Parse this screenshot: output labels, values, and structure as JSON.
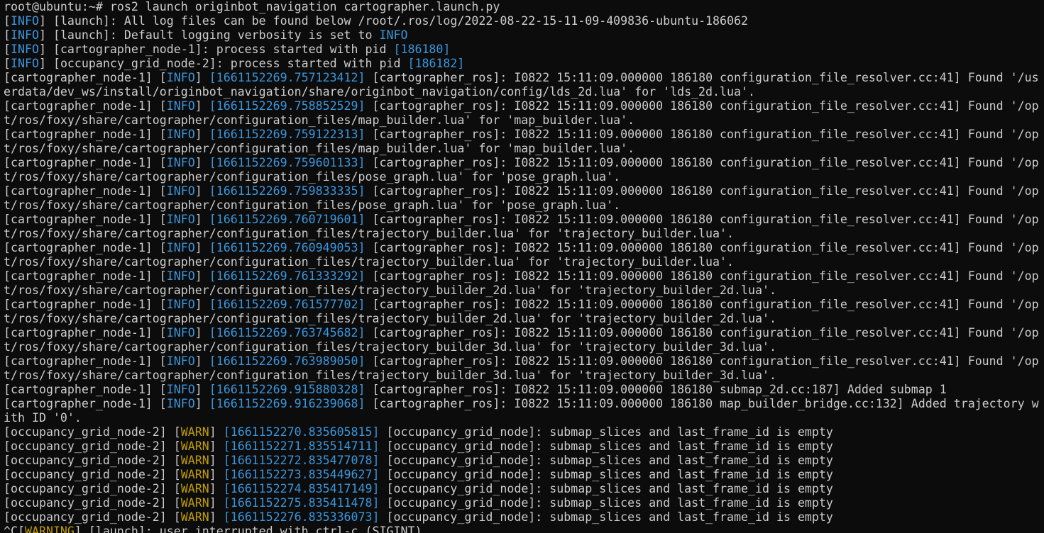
{
  "window": {
    "background": "#0c0c0c",
    "foreground": "#cccccc",
    "info_color": "#3a96dd",
    "warn_color": "#c19c00"
  },
  "lines": [
    [
      {
        "t": "root@ubuntu:~# ros2 launch originbot_navigation cartographer.launch.py",
        "c": "plain"
      }
    ],
    [
      {
        "t": "[",
        "c": "plain"
      },
      {
        "t": "INFO",
        "c": "tag-info"
      },
      {
        "t": "] [launch]: All log files can be found below /root/.ros/log/2022-08-22-15-11-09-409836-ubuntu-186062",
        "c": "plain"
      }
    ],
    [
      {
        "t": "[",
        "c": "plain"
      },
      {
        "t": "INFO",
        "c": "tag-info"
      },
      {
        "t": "] [launch]: Default logging verbosity is set to ",
        "c": "plain"
      },
      {
        "t": "INFO",
        "c": "tag-info"
      }
    ],
    [
      {
        "t": "[",
        "c": "plain"
      },
      {
        "t": "INFO",
        "c": "tag-info"
      },
      {
        "t": "] [cartographer_node-1]: process started with pid ",
        "c": "plain"
      },
      {
        "t": "[186180]",
        "c": "pid"
      }
    ],
    [
      {
        "t": "[",
        "c": "plain"
      },
      {
        "t": "INFO",
        "c": "tag-info"
      },
      {
        "t": "] [occupancy_grid_node-2]: process started with pid ",
        "c": "plain"
      },
      {
        "t": "[186182]",
        "c": "pid"
      }
    ],
    [
      {
        "t": "[cartographer_node-1] [",
        "c": "plain"
      },
      {
        "t": "INFO",
        "c": "tag-info"
      },
      {
        "t": "] ",
        "c": "plain"
      },
      {
        "t": "[1661152269.757123412]",
        "c": "ts"
      },
      {
        "t": " [cartographer_ros]: I0822 15:11:09.000000 186180 configuration_file_resolver.cc:41] Found '/us",
        "c": "plain"
      }
    ],
    [
      {
        "t": "erdata/dev_ws/install/originbot_navigation/share/originbot_navigation/config/lds_2d.lua' for 'lds_2d.lua'.",
        "c": "plain"
      }
    ],
    [
      {
        "t": "[cartographer_node-1] [",
        "c": "plain"
      },
      {
        "t": "INFO",
        "c": "tag-info"
      },
      {
        "t": "] ",
        "c": "plain"
      },
      {
        "t": "[1661152269.758852529]",
        "c": "ts"
      },
      {
        "t": " [cartographer_ros]: I0822 15:11:09.000000 186180 configuration_file_resolver.cc:41] Found '/op",
        "c": "plain"
      }
    ],
    [
      {
        "t": "t/ros/foxy/share/cartographer/configuration_files/map_builder.lua' for 'map_builder.lua'.",
        "c": "plain"
      }
    ],
    [
      {
        "t": "[cartographer_node-1] [",
        "c": "plain"
      },
      {
        "t": "INFO",
        "c": "tag-info"
      },
      {
        "t": "] ",
        "c": "plain"
      },
      {
        "t": "[1661152269.759122313]",
        "c": "ts"
      },
      {
        "t": " [cartographer_ros]: I0822 15:11:09.000000 186180 configuration_file_resolver.cc:41] Found '/op",
        "c": "plain"
      }
    ],
    [
      {
        "t": "t/ros/foxy/share/cartographer/configuration_files/map_builder.lua' for 'map_builder.lua'.",
        "c": "plain"
      }
    ],
    [
      {
        "t": "[cartographer_node-1] [",
        "c": "plain"
      },
      {
        "t": "INFO",
        "c": "tag-info"
      },
      {
        "t": "] ",
        "c": "plain"
      },
      {
        "t": "[1661152269.759601133]",
        "c": "ts"
      },
      {
        "t": " [cartographer_ros]: I0822 15:11:09.000000 186180 configuration_file_resolver.cc:41] Found '/op",
        "c": "plain"
      }
    ],
    [
      {
        "t": "t/ros/foxy/share/cartographer/configuration_files/pose_graph.lua' for 'pose_graph.lua'.",
        "c": "plain"
      }
    ],
    [
      {
        "t": "[cartographer_node-1] [",
        "c": "plain"
      },
      {
        "t": "INFO",
        "c": "tag-info"
      },
      {
        "t": "] ",
        "c": "plain"
      },
      {
        "t": "[1661152269.759833335]",
        "c": "ts"
      },
      {
        "t": " [cartographer_ros]: I0822 15:11:09.000000 186180 configuration_file_resolver.cc:41] Found '/op",
        "c": "plain"
      }
    ],
    [
      {
        "t": "t/ros/foxy/share/cartographer/configuration_files/pose_graph.lua' for 'pose_graph.lua'.",
        "c": "plain"
      }
    ],
    [
      {
        "t": "[cartographer_node-1] [",
        "c": "plain"
      },
      {
        "t": "INFO",
        "c": "tag-info"
      },
      {
        "t": "] ",
        "c": "plain"
      },
      {
        "t": "[1661152269.760719601]",
        "c": "ts"
      },
      {
        "t": " [cartographer_ros]: I0822 15:11:09.000000 186180 configuration_file_resolver.cc:41] Found '/op",
        "c": "plain"
      }
    ],
    [
      {
        "t": "t/ros/foxy/share/cartographer/configuration_files/trajectory_builder.lua' for 'trajectory_builder.lua'.",
        "c": "plain"
      }
    ],
    [
      {
        "t": "[cartographer_node-1] [",
        "c": "plain"
      },
      {
        "t": "INFO",
        "c": "tag-info"
      },
      {
        "t": "] ",
        "c": "plain"
      },
      {
        "t": "[1661152269.760949053]",
        "c": "ts"
      },
      {
        "t": " [cartographer_ros]: I0822 15:11:09.000000 186180 configuration_file_resolver.cc:41] Found '/op",
        "c": "plain"
      }
    ],
    [
      {
        "t": "t/ros/foxy/share/cartographer/configuration_files/trajectory_builder.lua' for 'trajectory_builder.lua'.",
        "c": "plain"
      }
    ],
    [
      {
        "t": "[cartographer_node-1] [",
        "c": "plain"
      },
      {
        "t": "INFO",
        "c": "tag-info"
      },
      {
        "t": "] ",
        "c": "plain"
      },
      {
        "t": "[1661152269.761333292]",
        "c": "ts"
      },
      {
        "t": " [cartographer_ros]: I0822 15:11:09.000000 186180 configuration_file_resolver.cc:41] Found '/op",
        "c": "plain"
      }
    ],
    [
      {
        "t": "t/ros/foxy/share/cartographer/configuration_files/trajectory_builder_2d.lua' for 'trajectory_builder_2d.lua'.",
        "c": "plain"
      }
    ],
    [
      {
        "t": "[cartographer_node-1] [",
        "c": "plain"
      },
      {
        "t": "INFO",
        "c": "tag-info"
      },
      {
        "t": "] ",
        "c": "plain"
      },
      {
        "t": "[1661152269.761577702]",
        "c": "ts"
      },
      {
        "t": " [cartographer_ros]: I0822 15:11:09.000000 186180 configuration_file_resolver.cc:41] Found '/op",
        "c": "plain"
      }
    ],
    [
      {
        "t": "t/ros/foxy/share/cartographer/configuration_files/trajectory_builder_2d.lua' for 'trajectory_builder_2d.lua'.",
        "c": "plain"
      }
    ],
    [
      {
        "t": "[cartographer_node-1] [",
        "c": "plain"
      },
      {
        "t": "INFO",
        "c": "tag-info"
      },
      {
        "t": "] ",
        "c": "plain"
      },
      {
        "t": "[1661152269.763745682]",
        "c": "ts"
      },
      {
        "t": " [cartographer_ros]: I0822 15:11:09.000000 186180 configuration_file_resolver.cc:41] Found '/op",
        "c": "plain"
      }
    ],
    [
      {
        "t": "t/ros/foxy/share/cartographer/configuration_files/trajectory_builder_3d.lua' for 'trajectory_builder_3d.lua'.",
        "c": "plain"
      }
    ],
    [
      {
        "t": "[cartographer_node-1] [",
        "c": "plain"
      },
      {
        "t": "INFO",
        "c": "tag-info"
      },
      {
        "t": "] ",
        "c": "plain"
      },
      {
        "t": "[1661152269.763989050]",
        "c": "ts"
      },
      {
        "t": " [cartographer_ros]: I0822 15:11:09.000000 186180 configuration_file_resolver.cc:41] Found '/op",
        "c": "plain"
      }
    ],
    [
      {
        "t": "t/ros/foxy/share/cartographer/configuration_files/trajectory_builder_3d.lua' for 'trajectory_builder_3d.lua'.",
        "c": "plain"
      }
    ],
    [
      {
        "t": "[cartographer_node-1] [",
        "c": "plain"
      },
      {
        "t": "INFO",
        "c": "tag-info"
      },
      {
        "t": "] ",
        "c": "plain"
      },
      {
        "t": "[1661152269.915880328]",
        "c": "ts"
      },
      {
        "t": " [cartographer_ros]: I0822 15:11:09.000000 186180 submap_2d.cc:187] Added submap 1",
        "c": "plain"
      }
    ],
    [
      {
        "t": "[cartographer_node-1] [",
        "c": "plain"
      },
      {
        "t": "INFO",
        "c": "tag-info"
      },
      {
        "t": "] ",
        "c": "plain"
      },
      {
        "t": "[1661152269.916239068]",
        "c": "ts"
      },
      {
        "t": " [cartographer_ros]: I0822 15:11:09.000000 186180 map_builder_bridge.cc:132] Added trajectory w",
        "c": "plain"
      }
    ],
    [
      {
        "t": "ith ID '0'.",
        "c": "plain"
      }
    ],
    [
      {
        "t": "[occupancy_grid_node-2] [",
        "c": "plain"
      },
      {
        "t": "WARN",
        "c": "tag-warn"
      },
      {
        "t": "] ",
        "c": "plain"
      },
      {
        "t": "[1661152270.835605815]",
        "c": "ts"
      },
      {
        "t": " [occupancy_grid_node]: submap_slices and last_frame_id is empty",
        "c": "plain"
      }
    ],
    [
      {
        "t": "[occupancy_grid_node-2] [",
        "c": "plain"
      },
      {
        "t": "WARN",
        "c": "tag-warn"
      },
      {
        "t": "] ",
        "c": "plain"
      },
      {
        "t": "[1661152271.835514711]",
        "c": "ts"
      },
      {
        "t": " [occupancy_grid_node]: submap_slices and last_frame_id is empty",
        "c": "plain"
      }
    ],
    [
      {
        "t": "[occupancy_grid_node-2] [",
        "c": "plain"
      },
      {
        "t": "WARN",
        "c": "tag-warn"
      },
      {
        "t": "] ",
        "c": "plain"
      },
      {
        "t": "[1661152272.835477078]",
        "c": "ts"
      },
      {
        "t": " [occupancy_grid_node]: submap_slices and last_frame_id is empty",
        "c": "plain"
      }
    ],
    [
      {
        "t": "[occupancy_grid_node-2] [",
        "c": "plain"
      },
      {
        "t": "WARN",
        "c": "tag-warn"
      },
      {
        "t": "] ",
        "c": "plain"
      },
      {
        "t": "[1661152273.835449627]",
        "c": "ts"
      },
      {
        "t": " [occupancy_grid_node]: submap_slices and last_frame_id is empty",
        "c": "plain"
      }
    ],
    [
      {
        "t": "[occupancy_grid_node-2] [",
        "c": "plain"
      },
      {
        "t": "WARN",
        "c": "tag-warn"
      },
      {
        "t": "] ",
        "c": "plain"
      },
      {
        "t": "[1661152274.835417149]",
        "c": "ts"
      },
      {
        "t": " [occupancy_grid_node]: submap_slices and last_frame_id is empty",
        "c": "plain"
      }
    ],
    [
      {
        "t": "[occupancy_grid_node-2] [",
        "c": "plain"
      },
      {
        "t": "WARN",
        "c": "tag-warn"
      },
      {
        "t": "] ",
        "c": "plain"
      },
      {
        "t": "[1661152275.835411478]",
        "c": "ts"
      },
      {
        "t": " [occupancy_grid_node]: submap_slices and last_frame_id is empty",
        "c": "plain"
      }
    ],
    [
      {
        "t": "[occupancy_grid_node-2] [",
        "c": "plain"
      },
      {
        "t": "WARN",
        "c": "tag-warn"
      },
      {
        "t": "] ",
        "c": "plain"
      },
      {
        "t": "[1661152276.835336073]",
        "c": "ts"
      },
      {
        "t": " [occupancy_grid_node]: submap_slices and last_frame_id is empty",
        "c": "plain"
      }
    ],
    [
      {
        "t": "^C[",
        "c": "plain"
      },
      {
        "t": "WARNING",
        "c": "tag-warn"
      },
      {
        "t": "] [launch]: user interrupted with ctrl-c (SIGINT)",
        "c": "plain"
      }
    ]
  ]
}
